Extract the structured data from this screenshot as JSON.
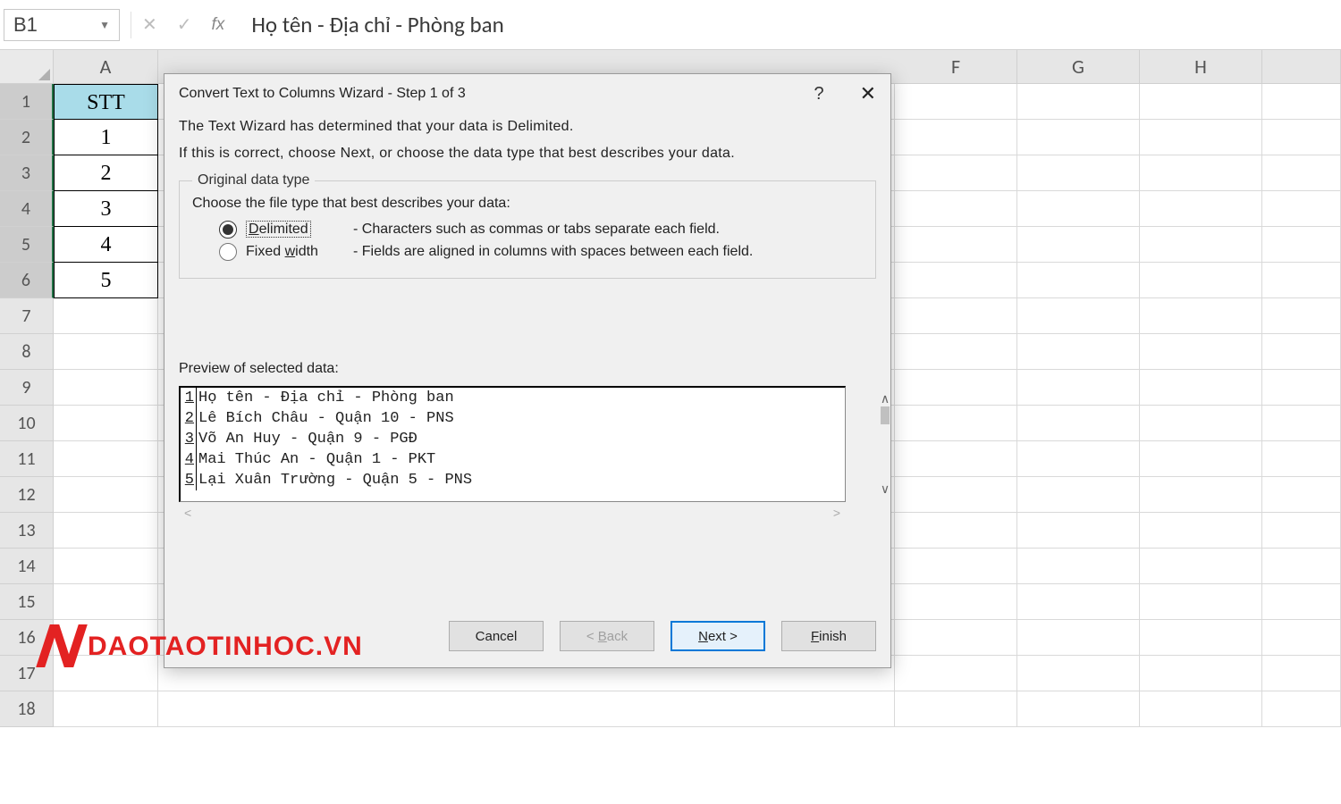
{
  "formula_bar": {
    "cell_ref": "B1",
    "value": "Họ tên - Địa chỉ - Phòng ban",
    "fx_label": "fx"
  },
  "columns": [
    "A",
    "F",
    "G",
    "H"
  ],
  "row_headers": [
    1,
    2,
    3,
    4,
    5,
    6,
    7,
    8,
    9,
    10,
    11,
    12,
    13,
    14,
    15,
    16,
    17,
    18
  ],
  "colA": {
    "header": "STT",
    "values": [
      "1",
      "2",
      "3",
      "4",
      "5"
    ]
  },
  "dialog": {
    "title": "Convert Text to Columns Wizard - Step 1 of 3",
    "intro1": "The Text Wizard has determined that your data is Delimited.",
    "intro2": "If this is correct, choose Next, or choose the data type that best describes your data.",
    "group_legend": "Original data type",
    "group_desc": "Choose the file type that best describes your data:",
    "opt_delimited": "Delimited",
    "opt_delimited_expl": "- Characters such as commas or tabs separate each field.",
    "opt_fixed": "Fixed width",
    "opt_fixed_expl": "- Fields are aligned in columns with spaces between each field.",
    "preview_label": "Preview of selected data:",
    "preview": [
      {
        "n": "1",
        "t": "Họ tên - Địa chỉ - Phòng ban"
      },
      {
        "n": "2",
        "t": "Lê Bích Châu - Quận 10 - PNS"
      },
      {
        "n": "3",
        "t": "Võ An Huy - Quận 9 - PGĐ"
      },
      {
        "n": "4",
        "t": "Mai Thúc An - Quận 1 - PKT"
      },
      {
        "n": "5",
        "t": "Lại Xuân Trường - Quận 5 - PNS"
      }
    ],
    "buttons": {
      "cancel": "Cancel",
      "back": "< Back",
      "next": "Next >",
      "finish": "Finish"
    }
  },
  "watermark": "DAOTAOTINHOC.VN"
}
